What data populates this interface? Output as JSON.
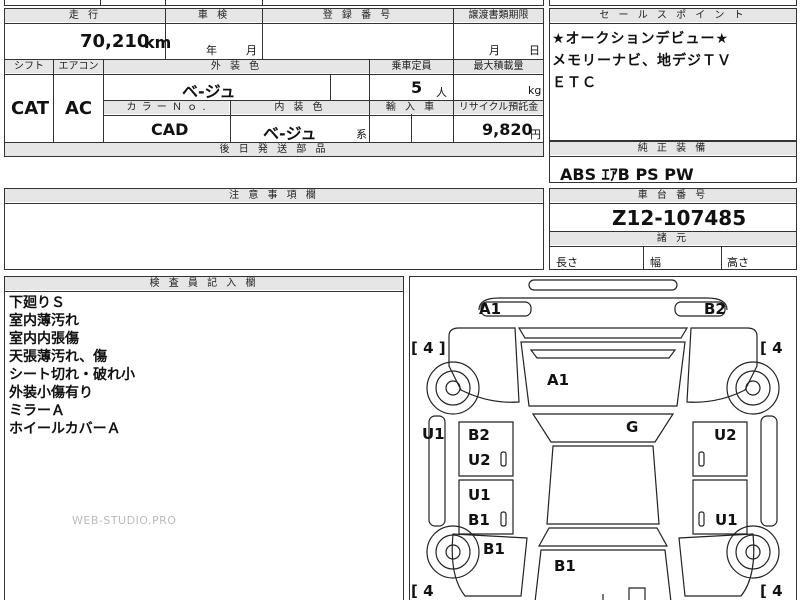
{
  "top_cut": {
    "fragment": "田 力 外"
  },
  "specs": {
    "mileage_label": "走 行",
    "mileage_value": "70,210",
    "mileage_unit": "km",
    "inspection_label": "車 検",
    "inspection_year": "年",
    "inspection_month": "月",
    "registration_label": "登 録 番 号",
    "transfer_label": "譲渡書類期限",
    "transfer_month": "月",
    "transfer_day": "日",
    "shift_label": "シフト",
    "shift_value": "CAT",
    "ac_label": "エアコン",
    "ac_value": "AC",
    "exterior_color_label": "外 装 色",
    "exterior_color_value": "ベ-ジュ",
    "capacity_label": "乗車定員",
    "capacity_value": "5",
    "capacity_unit": "人",
    "max_load_label": "最大積載量",
    "max_load_unit": "kg",
    "color_no_label": "カ ラ ー Ｎ ｏ .",
    "color_no_value": "CAD",
    "interior_color_label": "内 装 色",
    "interior_color_value": "ベ-ジュ",
    "interior_color_suffix": "系",
    "import_label": "輸 入 車",
    "recycle_label": "リサイクル預託金",
    "recycle_value": "9,820",
    "recycle_unit": "円",
    "later_parts_label": "後 日 発 送 部 品"
  },
  "sales_points": {
    "label": "セ ー ル ス ポ イ ン ト",
    "lines": [
      "★オークションデビュー★",
      "メモリーナビ、地デジＴＶ",
      "ＥＴＣ"
    ]
  },
  "equipment": {
    "label": "純 正 装 備",
    "value": "ABS ｴｱB PS PW"
  },
  "caution": {
    "label": "注 意 事 項 欄"
  },
  "chassis": {
    "label": "車 台 番 号",
    "value": "Z12-107485"
  },
  "dimensions": {
    "label": "諸 元",
    "length": "長さ",
    "width": "幅",
    "height": "高さ"
  },
  "inspector": {
    "label": "検 査 員 記 入 欄",
    "notes": [
      "下廻りＳ",
      "室内薄汚れ",
      "室内内張傷",
      "天張薄汚れ、傷",
      "シート切れ・破れ小",
      "外装小傷有り",
      "ミラーＡ",
      "ホイールカバーＡ"
    ]
  },
  "watermark": "WEB-STUDIO.PRO",
  "diagram": {
    "marks": [
      {
        "id": "a1-front-left",
        "text": "A1"
      },
      {
        "id": "b2-front-right",
        "text": "B2"
      },
      {
        "id": "a1-hood",
        "text": "A1"
      },
      {
        "id": "g-windshield",
        "text": "G"
      },
      {
        "id": "u1-left-side",
        "text": "U1"
      },
      {
        "id": "u2-right-side",
        "text": "U2"
      },
      {
        "id": "b2-left-front-door",
        "text": "B2"
      },
      {
        "id": "u2-left-front-door",
        "text": "U2"
      },
      {
        "id": "u1-left-rear-door",
        "text": "U1"
      },
      {
        "id": "b1-left-rear-door",
        "text": "B1"
      },
      {
        "id": "u1-right-rear-door",
        "text": "U1"
      },
      {
        "id": "b1-rear-left",
        "text": "B1"
      },
      {
        "id": "b1-rear",
        "text": "B1"
      }
    ],
    "tread": [
      {
        "id": "front-left",
        "text": "[ 4 ]"
      },
      {
        "id": "front-right",
        "text": "[ 4"
      },
      {
        "id": "rear-left",
        "text": "[ 4"
      },
      {
        "id": "rear-right",
        "text": "[ 4"
      }
    ]
  }
}
